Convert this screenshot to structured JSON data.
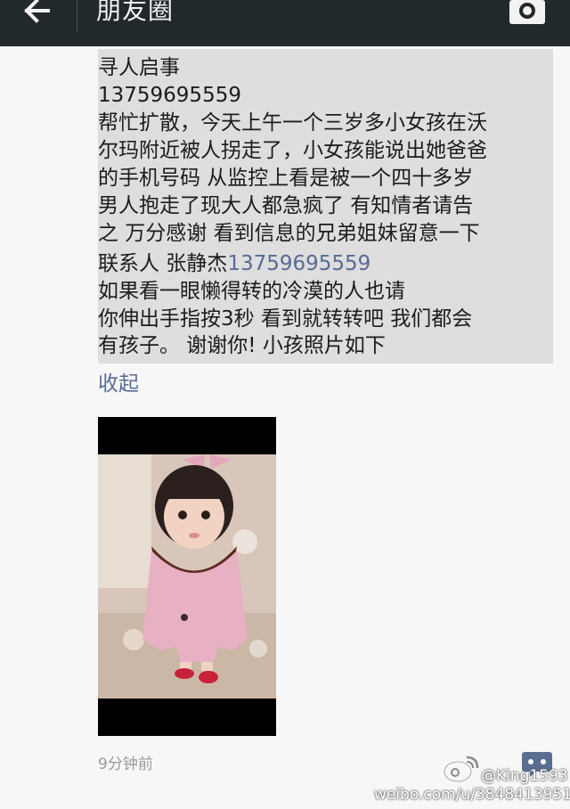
{
  "header": {
    "title": "朋友圈",
    "back_icon": "arrow-left-icon",
    "camera_icon": "camera-icon"
  },
  "post": {
    "lines": [
      "寻人启事",
      "13759695559",
      "帮忙扩散，今天上午一个三岁多小女孩在沃",
      "尔玛附近被人拐走了，小女孩能说出她爸爸",
      "的手机号码 从监控上看是被一个四十多岁",
      "男人抱走了现大人都急疯了 有知情者请告",
      "之 万分感谢 看到信息的兄弟姐妹留意一下",
      "如果看一眼懒得转的冷漠的人也请",
      "你伸出手指按3秒 看到就转转吧 我们都会",
      "有孩子。 谢谢你! 小孩照片如下"
    ],
    "contact_prefix": "联系人 张静杰",
    "contact_phone": "13759695559",
    "collapse_label": "收起",
    "time": "9分钟前",
    "comment_icon": "comment-icon",
    "photo_icon": "child-photo"
  },
  "watermark": {
    "handle": "@King1593",
    "url": "weibo.com/u/3848413951"
  },
  "colors": {
    "topbar": "#22292c",
    "link": "#586b94",
    "text_highlight_bg": "#dedede",
    "page_bg": "#f7f7f7"
  }
}
